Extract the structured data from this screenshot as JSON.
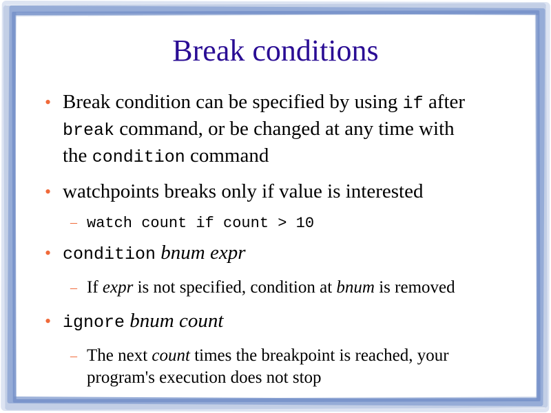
{
  "slide": {
    "title": "Break conditions",
    "bullets": [
      {
        "level": 1,
        "parts": [
          {
            "t": "Break condition can be specified by using ",
            "s": "n"
          },
          {
            "t": "if",
            "s": "m"
          },
          {
            "t": " after",
            "s": "n"
          },
          {
            "t": "break",
            "s": "m"
          },
          {
            "t": " command, or be changed at any time with",
            "s": "n"
          },
          {
            "t": "the ",
            "s": "n"
          },
          {
            "t": "condition",
            "s": "m"
          },
          {
            "t": " command",
            "s": "n"
          }
        ]
      },
      {
        "level": 1,
        "parts": [
          {
            "t": "watchpoints breaks only if value is interested",
            "s": "n"
          }
        ]
      },
      {
        "level": 2,
        "parts": [
          {
            "t": "watch count if count > 10",
            "s": "m"
          }
        ]
      },
      {
        "level": 1,
        "parts": [
          {
            "t": "condition",
            "s": "m"
          },
          {
            "t": " ",
            "s": "n"
          },
          {
            "t": "bnum expr",
            "s": "i"
          }
        ]
      },
      {
        "level": 2,
        "parts": [
          {
            "t": "If ",
            "s": "n"
          },
          {
            "t": "expr",
            "s": "i"
          },
          {
            "t": " is not specified, condition at ",
            "s": "n"
          },
          {
            "t": "bnum",
            "s": "i"
          },
          {
            "t": " is removed",
            "s": "n"
          }
        ]
      },
      {
        "level": 1,
        "parts": [
          {
            "t": "ignore",
            "s": "m"
          },
          {
            "t": " ",
            "s": "n"
          },
          {
            "t": "bnum count",
            "s": "i"
          }
        ]
      },
      {
        "level": 2,
        "parts": [
          {
            "t": "The next ",
            "s": "n"
          },
          {
            "t": "count",
            "s": "i"
          },
          {
            "t": " times the breakpoint is reached, your",
            "s": "n"
          },
          {
            "t": "program's execution does not stop",
            "s": "n"
          }
        ]
      }
    ],
    "bullet_glyphs": {
      "level1": "•",
      "level2": "–"
    },
    "colors": {
      "title": "#2a0d94",
      "bullet": "#f06a3a",
      "frame": "#8ea6d4"
    }
  }
}
